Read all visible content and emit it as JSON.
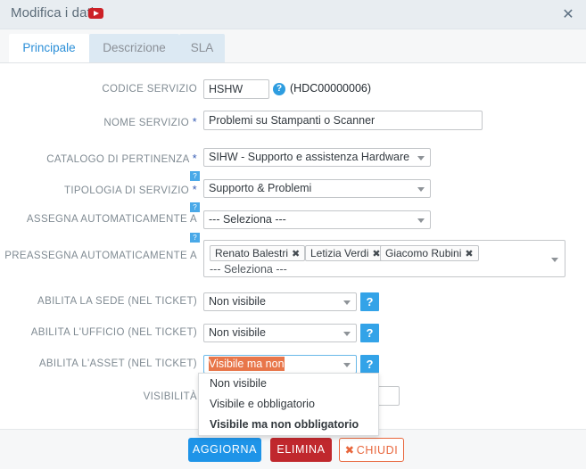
{
  "header": {
    "title": "Modifica i dati",
    "media_icon": "youtube-play-icon",
    "close_label": "✕"
  },
  "tabs": [
    {
      "label": "Principale",
      "active": true
    },
    {
      "label": "Descrizione",
      "active": false
    },
    {
      "label": "SLA",
      "active": false
    }
  ],
  "form": {
    "codice_servizio": {
      "label": "CODICE SERVIZIO",
      "value": "HSHW",
      "help": "?",
      "side_code": "(HDC00000006)"
    },
    "nome_servizio": {
      "label": "NOME SERVIZIO",
      "required": "*",
      "value": "Problemi su  Stampanti o Scanner"
    },
    "catalogo": {
      "label": "CATALOGO DI PERTINENZA",
      "required": "*",
      "value": "SIHW - Supporto e assistenza Hardware"
    },
    "tipologia": {
      "label": "TIPOLOGIA DI SERVIZIO",
      "required": "*",
      "value": "Supporto & Problemi",
      "help": "?"
    },
    "assegna": {
      "label": "ASSEGNA AUTOMATICAMENTE A",
      "value": "--- Seleziona ---",
      "help": "?"
    },
    "preassegna": {
      "label": "PREASSEGNA AUTOMATICAMENTE A",
      "help": "?",
      "placeholder": "--- Seleziona ---",
      "chips": [
        {
          "name": "Renato Balestri",
          "remove": "✖"
        },
        {
          "name": "Letizia Verdi",
          "remove": "✖"
        },
        {
          "name": "Giacomo Rubini",
          "remove": "✖"
        }
      ]
    },
    "abilita_sede": {
      "label": "ABILITA LA SEDE (NEL TICKET)",
      "value": "Non visibile",
      "help": "?"
    },
    "abilita_ufficio": {
      "label": "ABILITA L'UFFICIO (NEL TICKET)",
      "value": "Non visibile",
      "help": "?"
    },
    "abilita_asset": {
      "label": "ABILITA L'ASSET (NEL TICKET)",
      "value": "Visibile ma non obbligatorio",
      "help": "?",
      "selected_highlight_color": "#e8764a",
      "focus_border_color": "#69b8e8"
    },
    "visibilita": {
      "label": "VISIBILITÀ",
      "value": ""
    }
  },
  "dropdown": {
    "open": true,
    "options": [
      {
        "label": "Non visibile",
        "selected": false
      },
      {
        "label": "Visibile e obbligatorio",
        "selected": false
      },
      {
        "label": "Visibile ma non obbligatorio",
        "selected": true
      }
    ]
  },
  "footer": {
    "update_label": "AGGIORNA",
    "delete_label": "ELIMINA",
    "close_icon": "✖",
    "close_label": "CHIUDI"
  },
  "colors": {
    "header_bg": "#e8edf1",
    "tab_active_text": "#2b8fd8",
    "tab_inactive_bg": "#dce9f3",
    "primary_button": "#1e94e8",
    "danger_button": "#c0282d",
    "close_button_outline": "#e8663c",
    "help_blue": "#33a3e8",
    "youtube_red": "#cc2127"
  }
}
